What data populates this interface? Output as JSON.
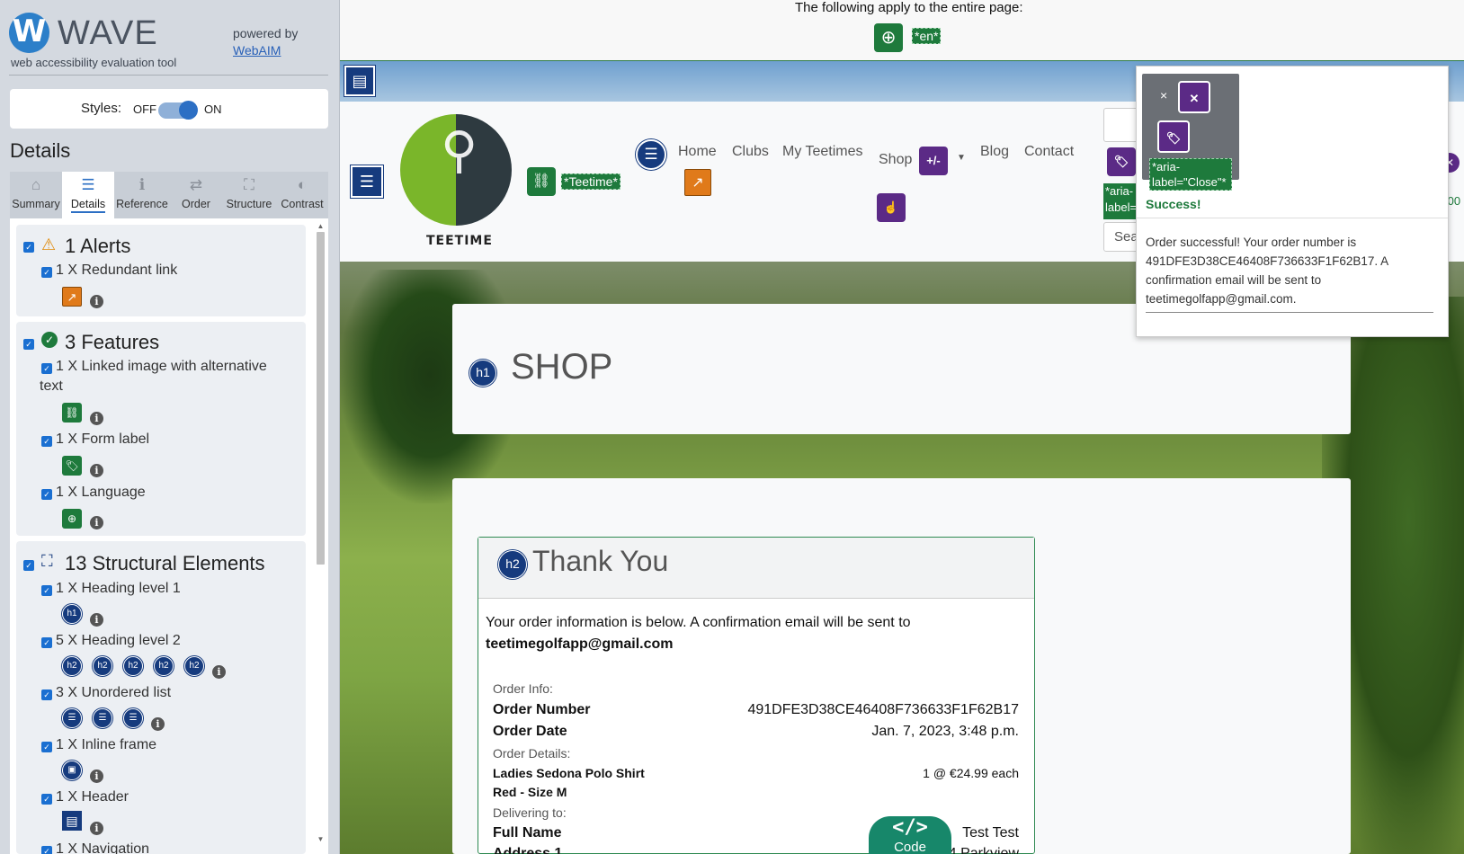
{
  "wave": {
    "logo_letter": "W",
    "title": "WAVE",
    "subtitle": "web accessibility evaluation tool",
    "powered_by": "powered by",
    "webaim": "WebAIM",
    "styles_label": "Styles:",
    "styles_off": "OFF",
    "styles_on": "ON",
    "details_heading": "Details"
  },
  "tabs": [
    {
      "label": "Summary",
      "icon": "home-icon",
      "glyph": "⌂"
    },
    {
      "label": "Details",
      "icon": "list-icon",
      "glyph": "☰"
    },
    {
      "label": "Reference",
      "icon": "info-icon",
      "glyph": "ℹ"
    },
    {
      "label": "Order",
      "icon": "order-icon",
      "glyph": "⇄"
    },
    {
      "label": "Structure",
      "icon": "structure-icon",
      "glyph": "⛶"
    },
    {
      "label": "Contrast",
      "icon": "contrast-icon",
      "glyph": "◐"
    }
  ],
  "alerts": {
    "title": "1 Alerts",
    "items": [
      "1 X Redundant link"
    ]
  },
  "features": {
    "title": "3 Features",
    "items": [
      "1 X Linked image with alternative text",
      "1 X Form label",
      "1 X Language"
    ]
  },
  "structure": {
    "title": "13 Structural Elements",
    "items": [
      "1 X Heading level 1",
      "5 X Heading level 2",
      "3 X Unordered list",
      "1 X Inline frame",
      "1 X Header",
      "1 X Navigation"
    ]
  },
  "icons": {
    "h1": "h1",
    "h2": "h2",
    "list": "☰",
    "frame": "▣",
    "header": "▤",
    "info": "i",
    "code": "</>"
  },
  "page": {
    "banner": "The following apply to the entire page:",
    "lang_label": "*en*",
    "teetime_label": "*Teetime*",
    "brand": "TEETIME",
    "nav": [
      "Home",
      "Clubs",
      "My Teetimes",
      "Shop",
      "Blog",
      "Contact"
    ],
    "plusminus": "+/-",
    "search_partial": "Sea",
    "aria_label_partial_1": "*aria-",
    "aria_label_partial_2": "label=",
    "shop_heading": "SHOP",
    "thank_heading": "Thank You",
    "order_intro": "Your order information is below. A confirmation email will be sent to",
    "order_email": "teetimegolfapp@gmail.com",
    "order_info_label": "Order Info:",
    "order_number_label": "Order Number",
    "order_number": "491DFE3D38CE46408F736633F1F62B17",
    "order_date_label": "Order Date",
    "order_date": "Jan. 7, 2023, 3:48 p.m.",
    "order_details_label": "Order Details:",
    "product_name": "Ladies Sedona Polo Shirt",
    "product_variant": "Red - Size M",
    "product_qty": "1 @ €24.99 each",
    "delivering_label": "Delivering to:",
    "full_name_label": "Full Name",
    "full_name": "Test Test",
    "address_label": "Address 1",
    "address_partial": "4 Parkview",
    "code_label": "Code",
    "partial_price": ".00"
  },
  "toast": {
    "title": "Success!",
    "body": "Order successful! Your order number is 491DFE3D38CE46408F736633F1F62B17. A confirmation email will be sent to teetimegolfapp@gmail.com.",
    "aria_close": "*aria-label=\"Close\"*",
    "close_x": "×"
  },
  "colors": {
    "accent": "#2c6fc4",
    "wave_green": "#1e7a3c",
    "wave_blue": "#163b7e",
    "wave_purple": "#5b2a86",
    "alert_orange": "#e07a1a"
  }
}
